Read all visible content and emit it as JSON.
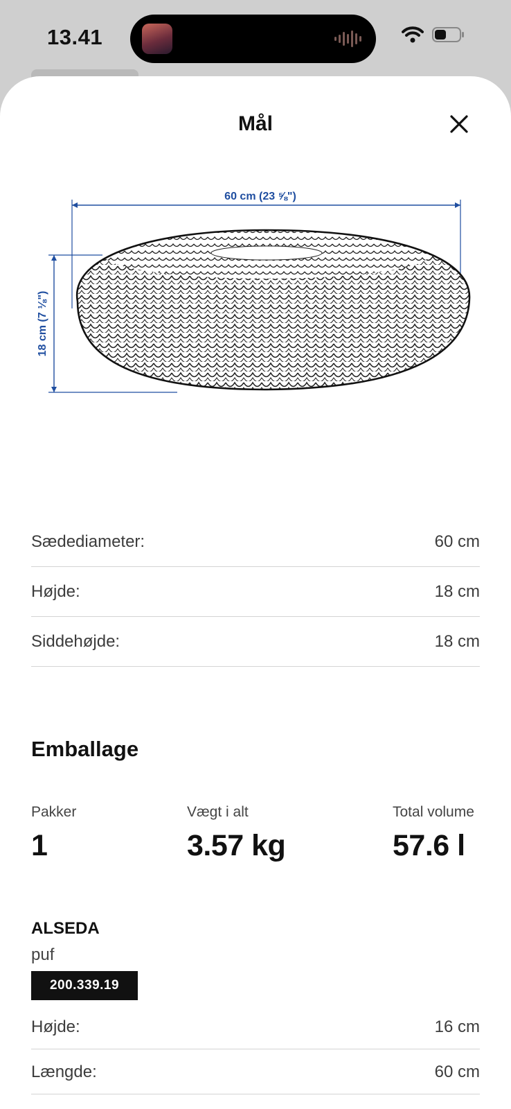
{
  "status_bar": {
    "time": "13.41"
  },
  "sheet": {
    "title": "Mål",
    "close_icon": "close-icon"
  },
  "diagram": {
    "width_label": "60 cm (23 ⅝\")",
    "height_label": "18 cm (7 ⅛\")"
  },
  "dimensions": [
    {
      "label": "Sædediameter:",
      "value": "60 cm"
    },
    {
      "label": "Højde:",
      "value": "18 cm"
    },
    {
      "label": "Siddehøjde:",
      "value": "18 cm"
    }
  ],
  "packaging": {
    "title": "Emballage",
    "stats": [
      {
        "label": "Pakker",
        "value": "1"
      },
      {
        "label": "Vægt i alt",
        "value": "3.57 kg"
      },
      {
        "label": "Total volume",
        "value": "57.6 l"
      }
    ],
    "product": {
      "name": "ALSEDA",
      "type": "puf",
      "article_number": "200.339.19"
    },
    "package_dimensions": [
      {
        "label": "Højde:",
        "value": "16 cm"
      },
      {
        "label": "Længde:",
        "value": "60 cm"
      }
    ]
  },
  "colors": {
    "dimension_blue": "#1f4ea0",
    "badge_black": "#111111",
    "divider": "#d4d4d4"
  }
}
